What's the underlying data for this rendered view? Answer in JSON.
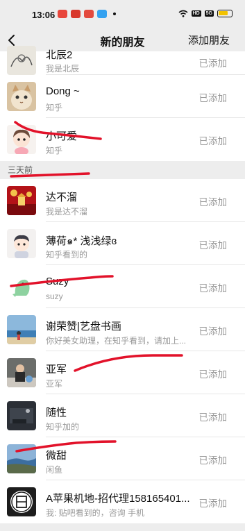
{
  "status_bar": {
    "time": "13:06",
    "right_tags": [
      "HD",
      "5G"
    ],
    "app_colors": [
      "#e8473c",
      "#d8382c",
      "#e34a3e",
      "#35a2f0"
    ]
  },
  "nav": {
    "back_icon": "chevron-left-icon",
    "title": "新的朋友",
    "action": "添加朋友"
  },
  "recent": [
    {
      "name": "北辰2",
      "sub": "我是北辰",
      "status": "已添加",
      "avatar": "sketch"
    },
    {
      "name": "Dong ~",
      "sub": "知乎",
      "status": "已添加",
      "avatar": "cat"
    },
    {
      "name": "小可爱",
      "sub": "知乎",
      "status": "已添加",
      "avatar": "cartoon-girl"
    }
  ],
  "section_label": "三天前",
  "earlier": [
    {
      "name": "达不溜",
      "sub": "我是达不溜",
      "status": "已添加",
      "avatar": "festive-red"
    },
    {
      "name": "薄荷๑* 浅浅绿ɞ",
      "sub": "知乎看到的",
      "status": "已添加",
      "avatar": "cartoon-boy"
    },
    {
      "name": "Suzy",
      "sub": "suzy",
      "status": "已添加",
      "avatar": "green-dino"
    },
    {
      "name": "谢荣赞|艺盘书画",
      "sub": "你好美女助理，在知乎看到，请加上...",
      "status": "已添加",
      "avatar": "beach"
    },
    {
      "name": "亚军",
      "sub": "亚军",
      "status": "已添加",
      "avatar": "person-photo"
    },
    {
      "name": "随性",
      "sub": "知乎加的",
      "status": "已添加",
      "avatar": "dark-photo"
    },
    {
      "name": "微甜",
      "sub": "闲鱼",
      "status": "已添加",
      "avatar": "coast"
    },
    {
      "name": "A苹果机地-招代理158165401...",
      "sub": "我: 贴吧看到的，咨询 手机",
      "status": "已添加",
      "avatar": "logo-seal"
    }
  ]
}
